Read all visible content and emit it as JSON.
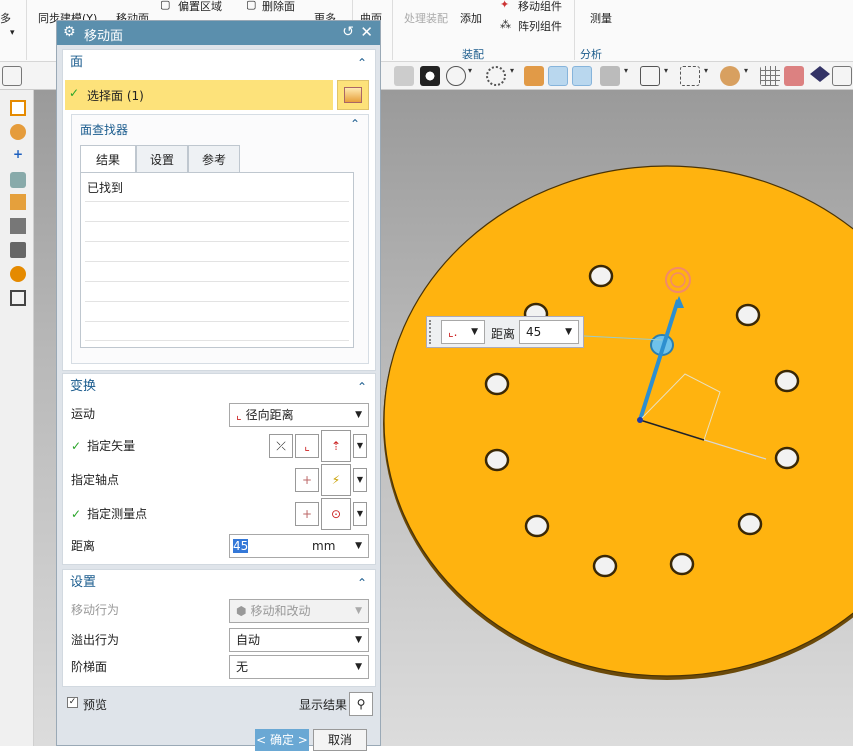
{
  "ribbon": {
    "items": [
      "多",
      "同步建模(Y)",
      "移动面",
      "偏置区域",
      "删除面",
      "更多",
      "曲面",
      "处理装配",
      "添加",
      "移动组件",
      "阵列组件",
      "测量"
    ],
    "groups": [
      "装配",
      "分析"
    ]
  },
  "dialog": {
    "title": "移动面",
    "face_section": {
      "title": "面",
      "select_face": "选择面 (1)",
      "finder_title": "面查找器",
      "tabs": [
        "结果",
        "设置",
        "参考"
      ],
      "found_label": "已找到"
    },
    "transform_section": {
      "title": "变换",
      "motion_label": "运动",
      "motion_value": "径向距离",
      "vector_label": "指定矢量",
      "axis_point_label": "指定轴点",
      "measure_point_label": "指定测量点",
      "distance_label": "距离",
      "distance_value": "45",
      "distance_unit": "mm"
    },
    "settings_section": {
      "title": "设置",
      "move_behavior_label": "移动行为",
      "move_behavior_value": "移动和改动",
      "overflow_label": "溢出行为",
      "overflow_value": "自动",
      "step_label": "阶梯面",
      "step_value": "无"
    },
    "preview_label": "预览",
    "show_result_label": "显示结果",
    "ok_label": "< 确定 >",
    "cancel_label": "取消"
  },
  "viewport": {
    "dist_label": "距离",
    "dist_value": "45"
  },
  "colors": {
    "part": "#ffb30f",
    "header": "#5b8fad",
    "highlight": "#fde27a",
    "ok_button": "#6aa8d4"
  }
}
